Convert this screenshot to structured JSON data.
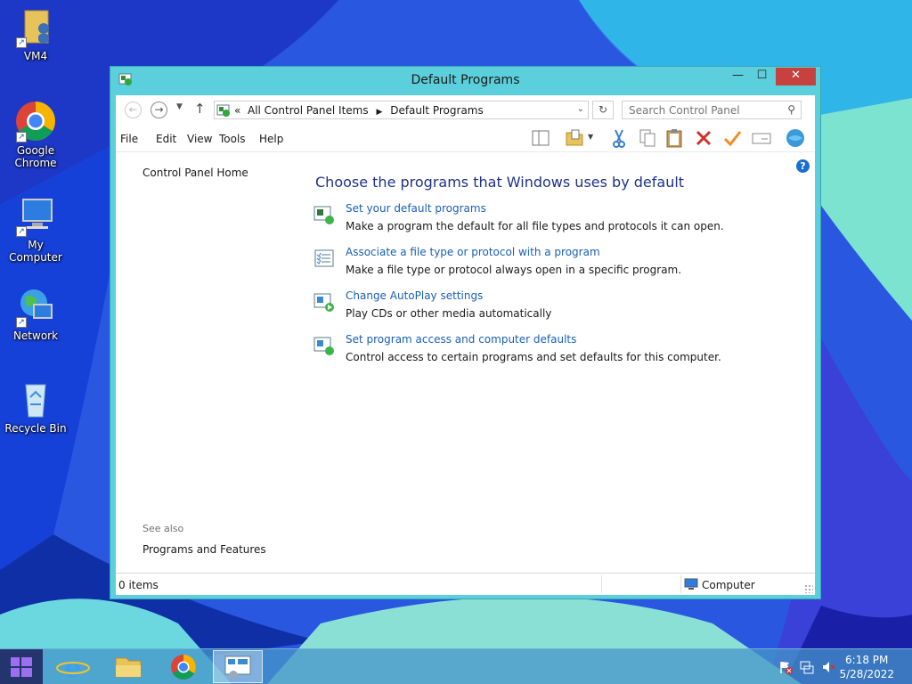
{
  "desktop": {
    "icons": [
      {
        "label": "VM4",
        "icon": "user-folder-icon"
      },
      {
        "label": "Google\nChrome",
        "icon": "chrome-icon"
      },
      {
        "label": "My Computer",
        "icon": "computer-icon"
      },
      {
        "label": "Network",
        "icon": "network-icon"
      },
      {
        "label": "Recycle Bin",
        "icon": "recycle-bin-icon"
      }
    ]
  },
  "window": {
    "title": "Default Programs",
    "address": {
      "overflow": "«",
      "crumbs": [
        "All Control Panel Items",
        "Default Programs"
      ]
    },
    "search_placeholder": "Search Control Panel",
    "menu": [
      "File",
      "Edit",
      "View",
      "Tools",
      "Help"
    ],
    "left_pane": {
      "home_link": "Control Panel Home",
      "see_also": "See also",
      "programs_features": "Programs and Features"
    },
    "heading": "Choose the programs that Windows uses by default",
    "tasks": [
      {
        "link": "Set your default programs",
        "desc": "Make a program the default for all file types and protocols it can open.",
        "icon": "default-programs-icon"
      },
      {
        "link": "Associate a file type or protocol with a program",
        "desc": "Make a file type or protocol always open in a specific program.",
        "icon": "file-association-icon"
      },
      {
        "link": "Change AutoPlay settings",
        "desc": "Play CDs or other media automatically",
        "icon": "autoplay-icon"
      },
      {
        "link": "Set program access and computer defaults",
        "desc": "Control access to certain programs and set defaults for this computer.",
        "icon": "program-access-icon"
      }
    ],
    "status": {
      "items": "0 items",
      "zone": "Computer"
    }
  },
  "taskbar": {
    "clock_time": "6:18 PM",
    "clock_date": "5/28/2022"
  },
  "colors": {
    "window_frame": "#5ccfdc",
    "close_button": "#c7423e",
    "link": "#1a5fb4",
    "heading": "#1e3287"
  }
}
